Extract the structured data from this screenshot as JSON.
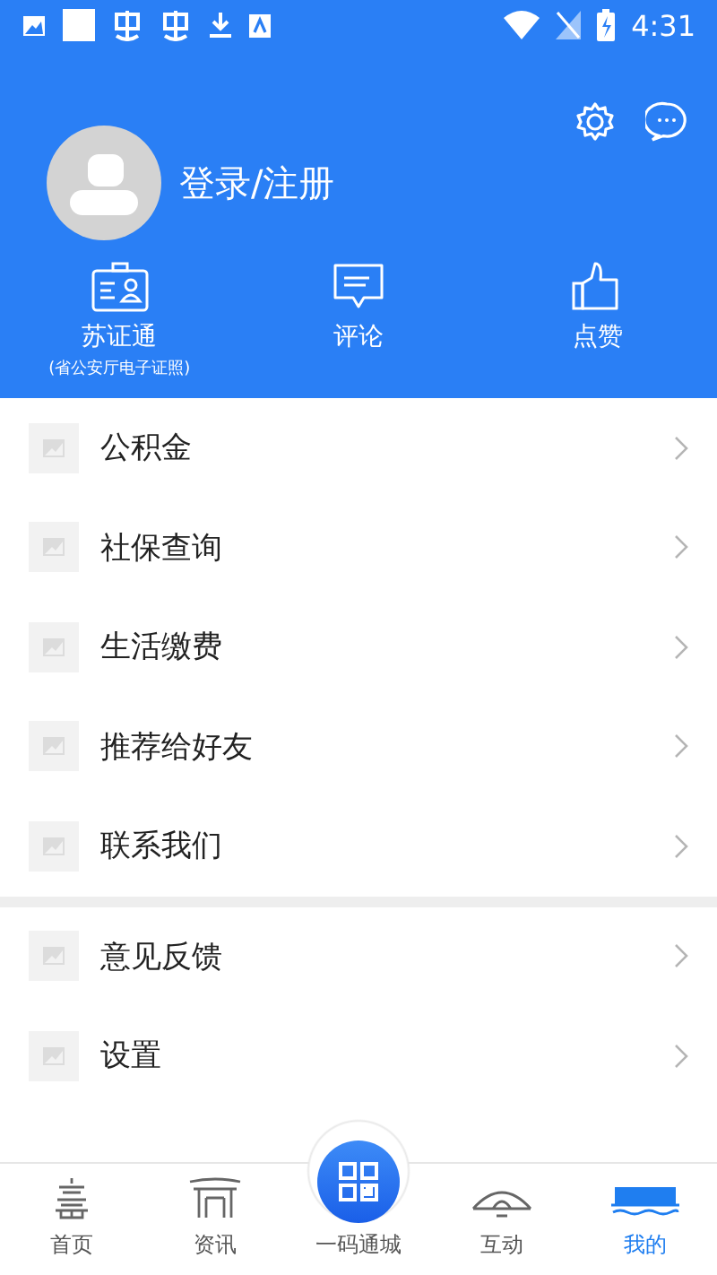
{
  "status_bar": {
    "time": "4:31"
  },
  "header": {
    "login_text": "登录/注册"
  },
  "quick_actions": [
    {
      "label": "苏证通",
      "sublabel": "(省公安厅电子证照)"
    },
    {
      "label": "评论"
    },
    {
      "label": "点赞"
    }
  ],
  "sections": [
    {
      "items": [
        {
          "label": "公积金"
        },
        {
          "label": "社保查询"
        },
        {
          "label": "生活缴费"
        },
        {
          "label": "推荐给好友"
        },
        {
          "label": "联系我们"
        }
      ]
    },
    {
      "items": [
        {
          "label": "意见反馈"
        },
        {
          "label": "设置"
        }
      ]
    }
  ],
  "bottom_nav": [
    {
      "label": "首页",
      "kind": "tab",
      "selected": false
    },
    {
      "label": "资讯",
      "kind": "tab",
      "selected": false
    },
    {
      "label": "一码通城",
      "kind": "center",
      "selected": false
    },
    {
      "label": "互动",
      "kind": "tab",
      "selected": false
    },
    {
      "label": "我的",
      "kind": "tab",
      "selected": true
    }
  ]
}
